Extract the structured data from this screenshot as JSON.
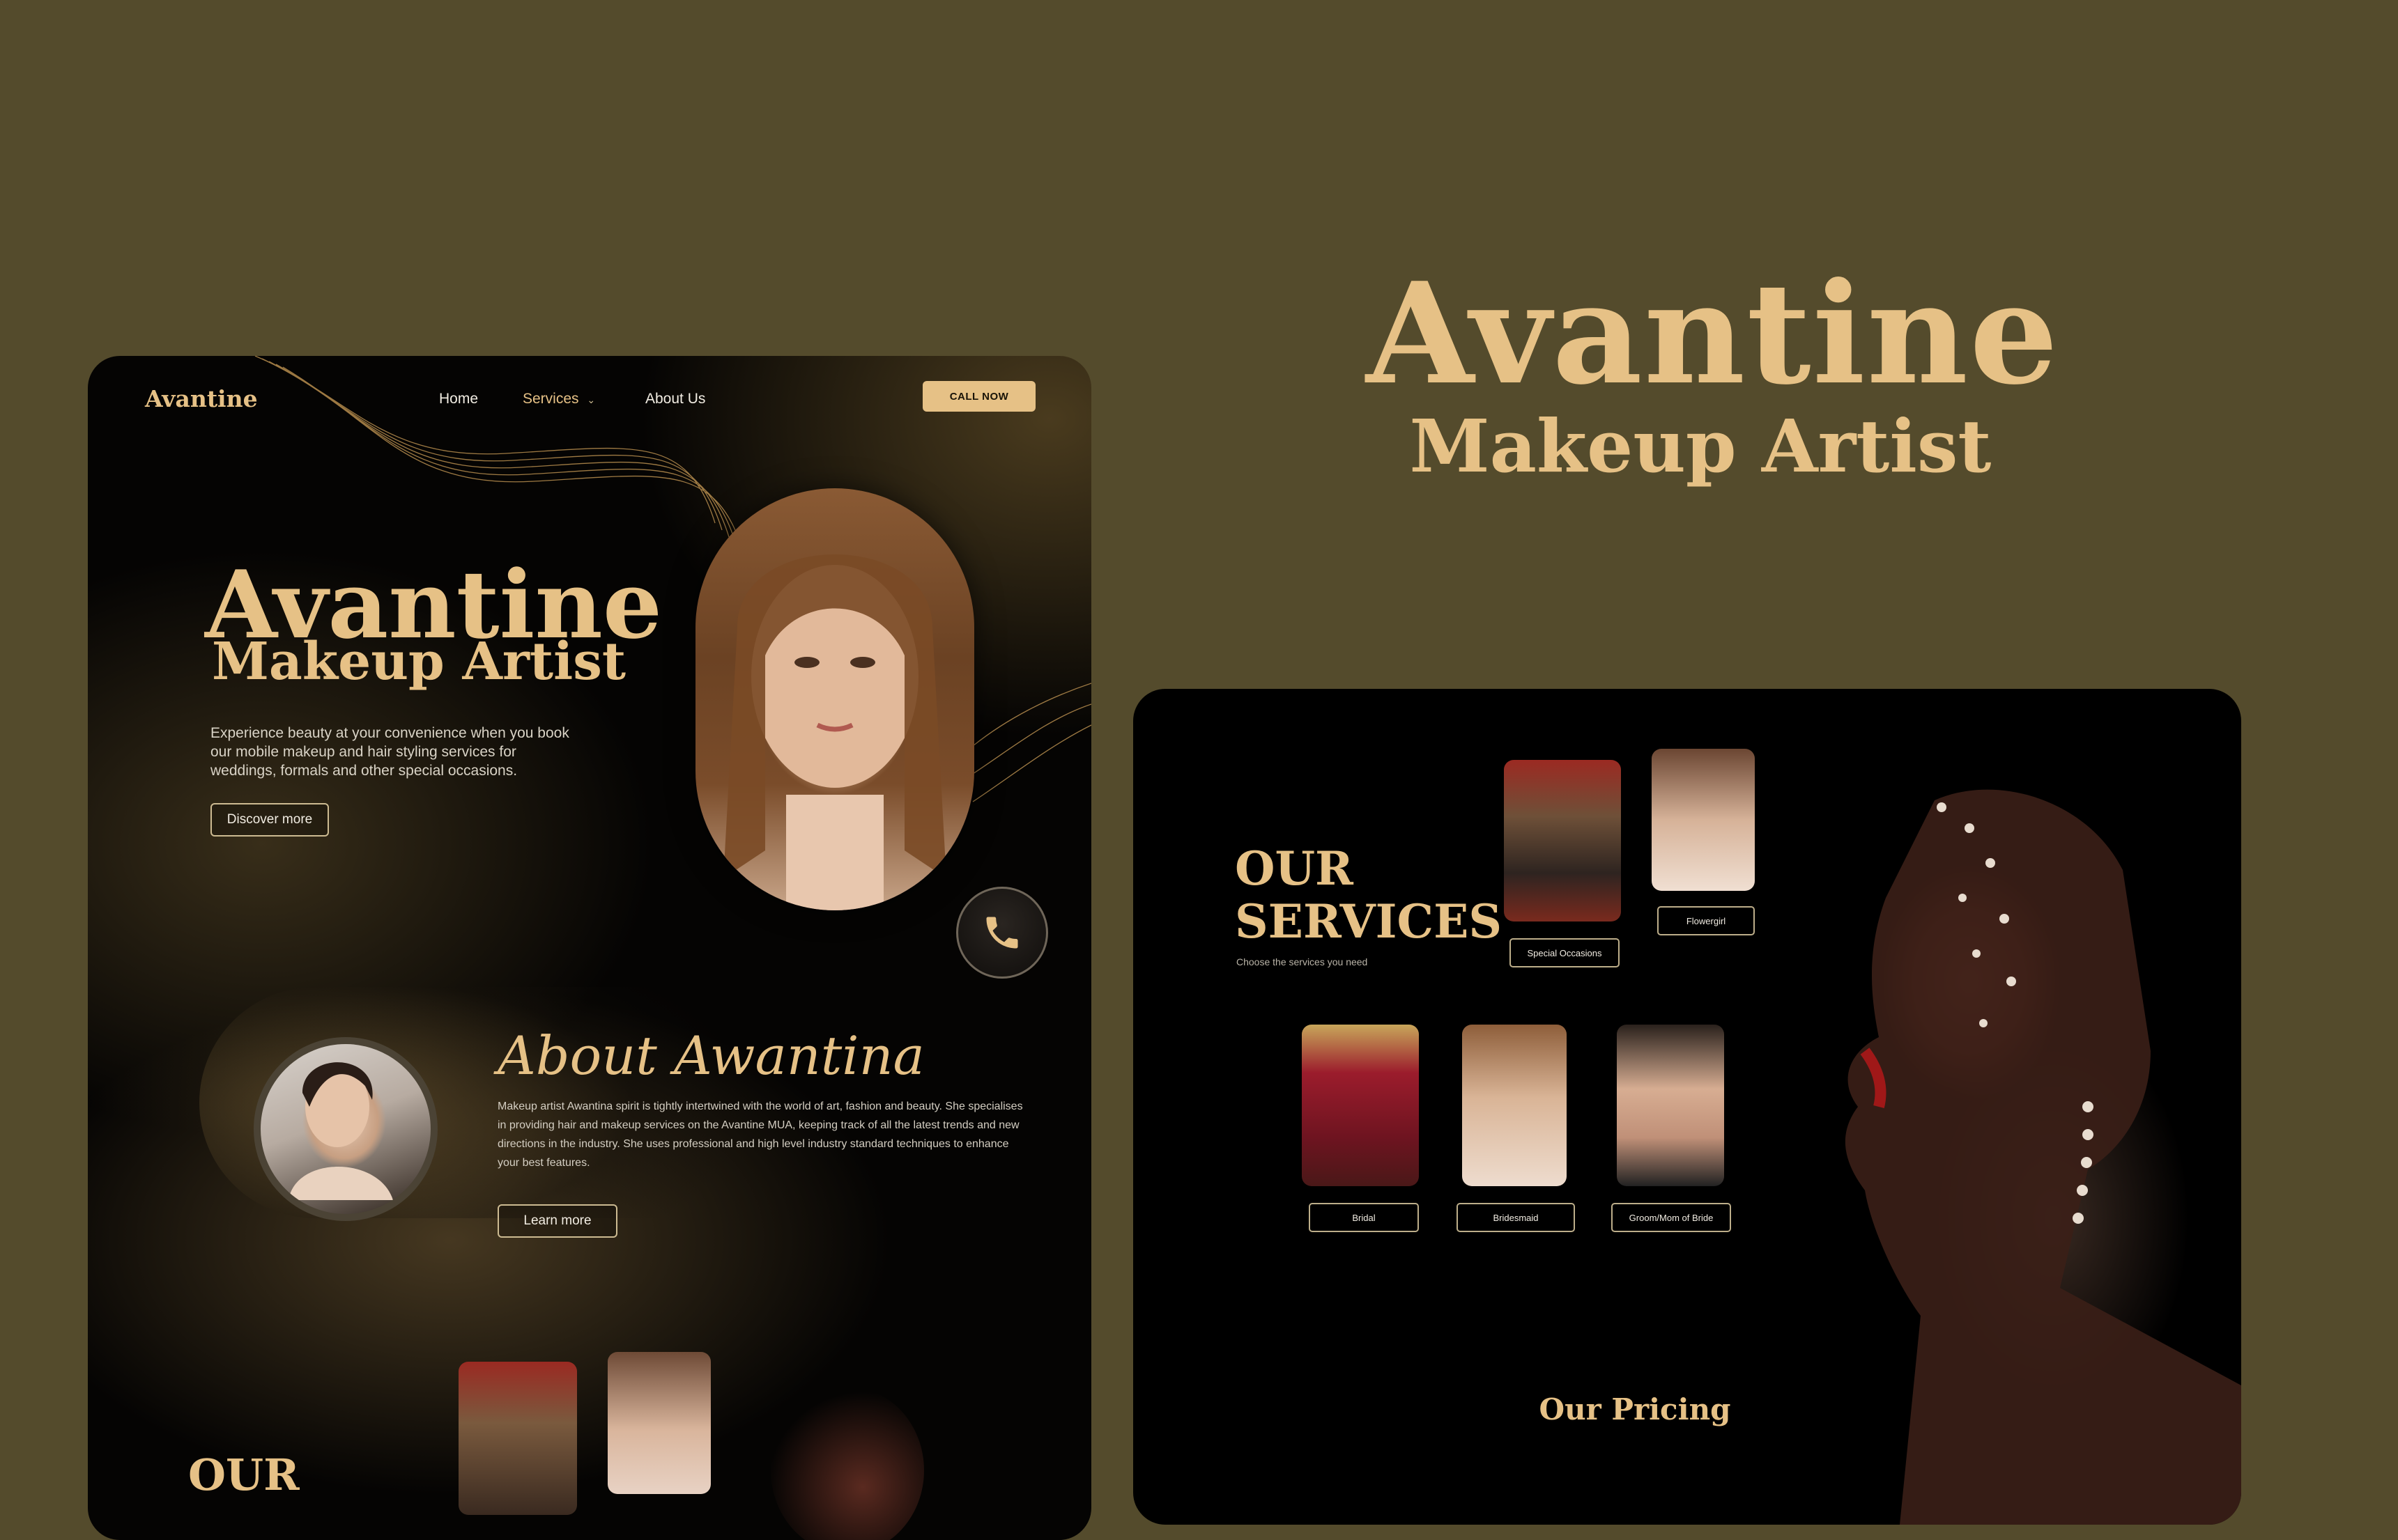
{
  "hero": {
    "title": "Avantine",
    "subtitle": "Makeup Artist"
  },
  "nav": {
    "logo": "Avantine",
    "links": [
      {
        "label": "Home"
      },
      {
        "label": "Services"
      },
      {
        "label": "About Us"
      }
    ],
    "cta": "CALL NOW"
  },
  "landing": {
    "title": "Avantine",
    "subtitle": "Makeup Artist",
    "description": "Experience beauty at your convenience when you book our mobile makeup and hair styling services for weddings, formals and other special occasions.",
    "button": "Discover more"
  },
  "about": {
    "title": "About Awantina",
    "description": "Makeup artist Awantina spirit is tightly intertwined with the world of art, fashion and beauty. She specialises in providing hair and makeup services on the Avantine MUA, keeping track of all the latest trends and new directions in the industry. She uses professional and high level industry standard techniques to enhance your best features.",
    "button": "Learn more"
  },
  "services_preview": {
    "title": "OUR"
  },
  "services": {
    "title_line1": "OUR",
    "title_line2": "SERVICES",
    "subtitle": "Choose the services you need",
    "items": [
      {
        "label": "Special Occasions"
      },
      {
        "label": "Flowergirl"
      },
      {
        "label": "Bridal"
      },
      {
        "label": "Bridesmaid"
      },
      {
        "label": "Groom/Mom of Bride"
      }
    ]
  },
  "pricing": {
    "title": "Our Pricing"
  },
  "colors": {
    "background": "#544b2c",
    "gold": "#e6c186",
    "card": "#050403"
  }
}
